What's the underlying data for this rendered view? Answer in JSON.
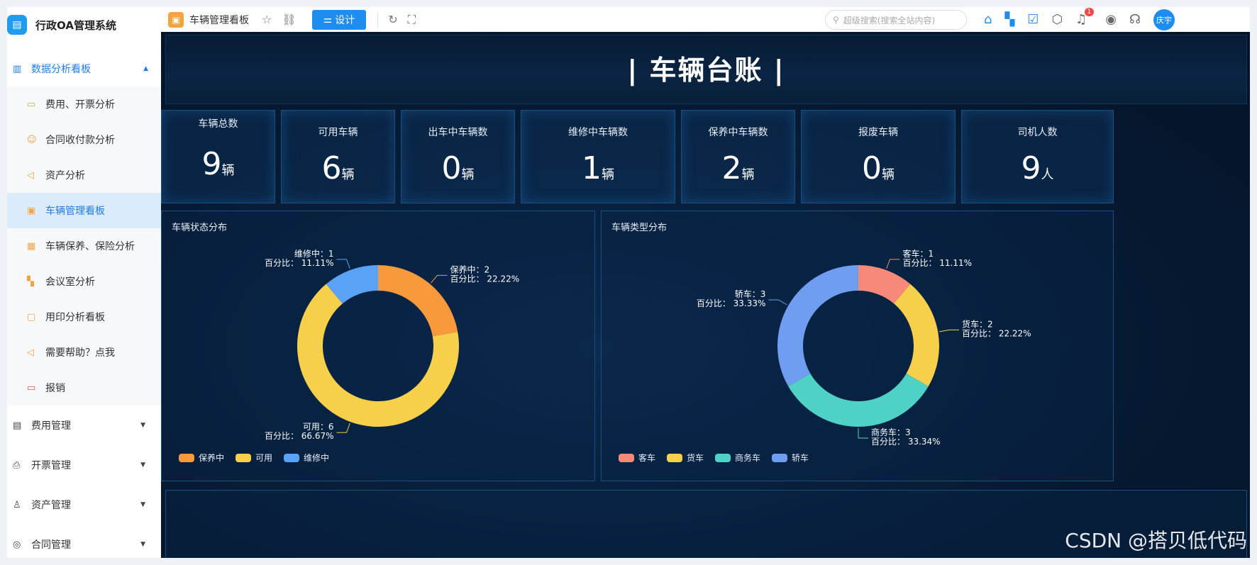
{
  "app": {
    "title": "行政OA管理系统",
    "logo_icon": "grid-doc-icon"
  },
  "sidebar": {
    "group": {
      "label": "数据分析看板",
      "expanded": true
    },
    "sub_items": [
      {
        "label": "费用、开票分析",
        "icon": "folder-icon"
      },
      {
        "label": "合同收付款分析",
        "icon": "users-icon"
      },
      {
        "label": "资产分析",
        "icon": "megaphone-icon"
      },
      {
        "label": "车辆管理看板",
        "icon": "briefcase-icon",
        "active": true
      },
      {
        "label": "车辆保养、保险分析",
        "icon": "calendar-icon"
      },
      {
        "label": "会议室分析",
        "icon": "apps-icon"
      },
      {
        "label": "用印分析看板",
        "icon": "badge-icon"
      },
      {
        "label": "需要帮助？点我",
        "icon": "megaphone-icon"
      },
      {
        "label": "报销",
        "icon": "folder-red-icon"
      }
    ],
    "top_items": [
      {
        "label": "费用管理",
        "icon": "document-icon"
      },
      {
        "label": "开票管理",
        "icon": "printer-icon"
      },
      {
        "label": "资产管理",
        "icon": "user-edit-icon"
      },
      {
        "label": "合同管理",
        "icon": "target-icon"
      }
    ]
  },
  "topbar": {
    "tab_title": "车辆管理看板",
    "design_label": "设计",
    "search_placeholder": "超级搜索(搜索全站内容)",
    "notification_count": "1",
    "user_name": "庆宇"
  },
  "dashboard": {
    "title": "|  车辆台账  |",
    "stats": [
      {
        "label": "车辆总数",
        "value": "9",
        "unit": "辆"
      },
      {
        "label": "可用车辆",
        "value": "6",
        "unit": "辆"
      },
      {
        "label": "出车中车辆数",
        "value": "0",
        "unit": "辆"
      },
      {
        "label": "维修中车辆数",
        "value": "1",
        "unit": "辆"
      },
      {
        "label": "保养中车辆数",
        "value": "2",
        "unit": "辆"
      },
      {
        "label": "报废车辆",
        "value": "0",
        "unit": "辆"
      },
      {
        "label": "司机人数",
        "value": "9",
        "unit": "人"
      }
    ]
  },
  "chart_data": [
    {
      "type": "pie",
      "title": "车辆状态分布",
      "legend": "bottom-left",
      "series": [
        {
          "name": "保养中",
          "value": 2,
          "percent": "22.22%",
          "color": "#f89a3c"
        },
        {
          "name": "可用",
          "value": 6,
          "percent": "66.67%",
          "color": "#f7d04b"
        },
        {
          "name": "维修中",
          "value": 1,
          "percent": "11.11%",
          "color": "#5aa2f5"
        }
      ],
      "label_prefix_value": "：",
      "label_prefix_percent": "百分比："
    },
    {
      "type": "pie",
      "title": "车辆类型分布",
      "legend": "bottom-left",
      "series": [
        {
          "name": "客车",
          "value": 1,
          "percent": "11.11%",
          "color": "#f7897b"
        },
        {
          "name": "货车",
          "value": 2,
          "percent": "22.22%",
          "color": "#f7d04b"
        },
        {
          "name": "商务车",
          "value": 3,
          "percent": "33.34%",
          "color": "#4fd1c5"
        },
        {
          "name": "轿车",
          "value": 3,
          "percent": "33.33%",
          "color": "#6f9ef0"
        }
      ],
      "label_prefix_value": "：",
      "label_prefix_percent": "百分比："
    }
  ],
  "watermark": "CSDN @搭贝低代码"
}
